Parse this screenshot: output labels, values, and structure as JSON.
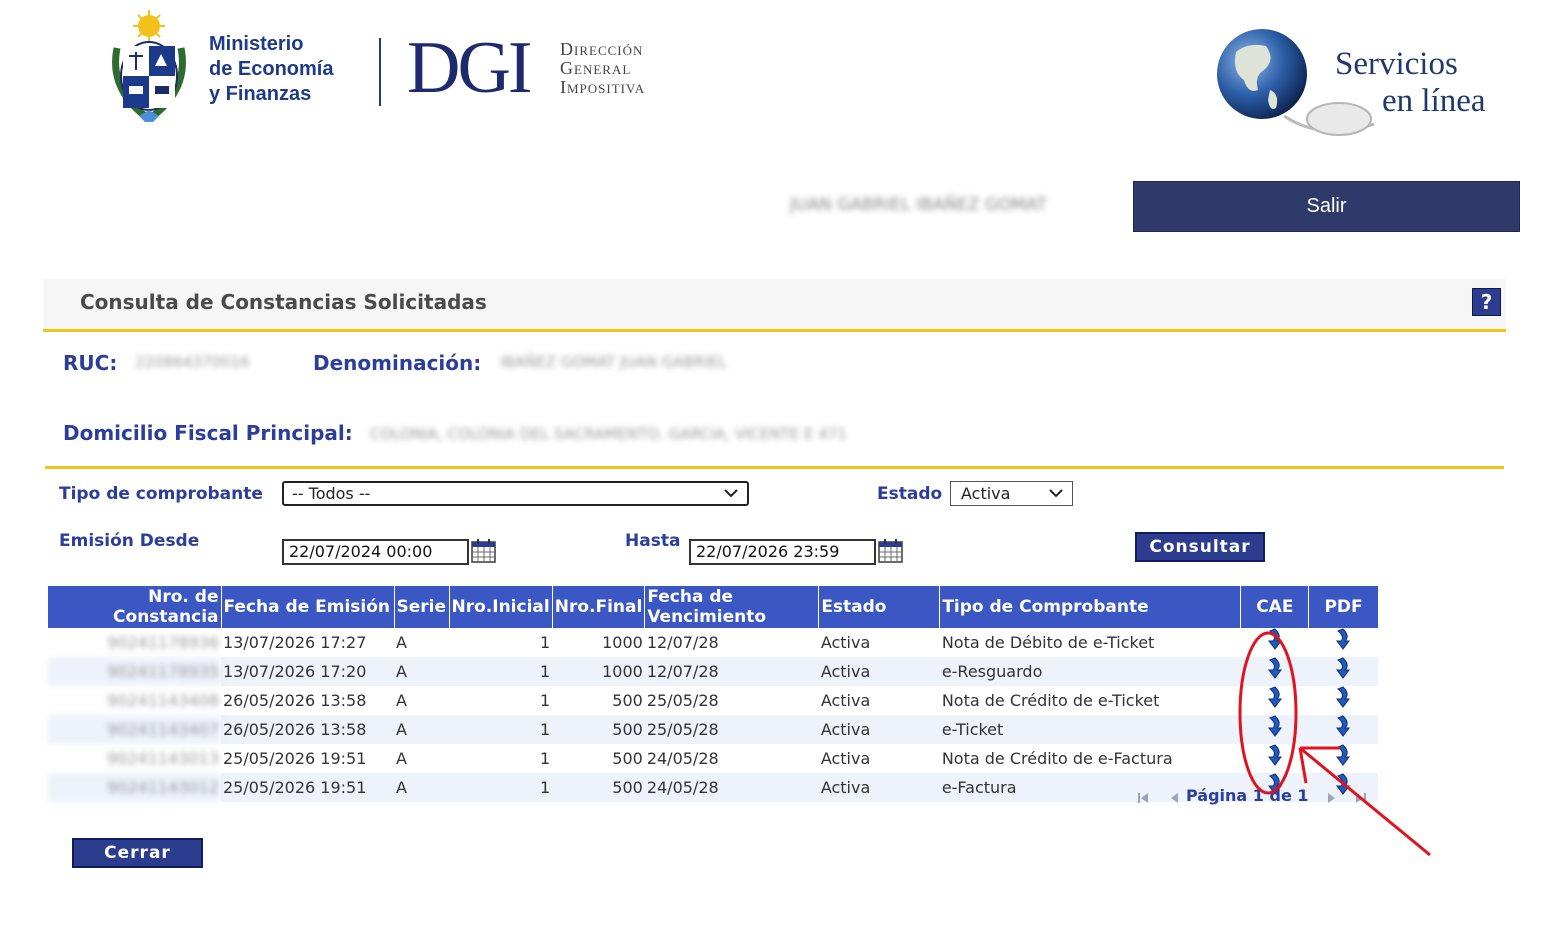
{
  "header": {
    "ministry_lines": [
      "Ministerio",
      "de Economía",
      "y Finanzas"
    ],
    "dgi_logo": "DGI",
    "dgi_lines": [
      "Dirección",
      "General",
      "Impositiva"
    ],
    "services_line1": "Servicios",
    "services_line2": "en línea",
    "user_name_blurred": "JUAN GABRIEL IBAÑEZ GOMAT",
    "logout_label": "Salir"
  },
  "panel": {
    "title": "Consulta de Constancias Solicitadas",
    "help_icon": "?"
  },
  "taxpayer": {
    "ruc_label": "RUC:",
    "ruc_value_blurred": "220864370016",
    "denominacion_label": "Denominación:",
    "denominacion_value_blurred": "IBAÑEZ GOMAT JUAN GABRIEL",
    "domicilio_label": "Domicilio Fiscal Principal:",
    "domicilio_value_blurred": "COLONIA, COLONIA DEL SACRAMENTO, GARCIA, VICENTE E 471"
  },
  "filters": {
    "tipo_label": "Tipo de comprobante",
    "tipo_value": "-- Todos --",
    "estado_label": "Estado",
    "estado_value": "Activa",
    "desde_label": "Emisión Desde",
    "desde_value": "22/07/2024 00:00",
    "hasta_label": "Hasta",
    "hasta_value": "22/07/2026 23:59",
    "consultar_label": "Consultar"
  },
  "table": {
    "columns": {
      "nro_l1": "Nro. de",
      "nro_l2": "Constancia",
      "fecha": "Fecha de Emisión",
      "serie": "Serie",
      "ini": "Nro.Inicial",
      "fin": "Nro.Final",
      "venc_l1": "Fecha de",
      "venc_l2": "Vencimiento",
      "estado": "Estado",
      "tipo": "Tipo de Comprobante",
      "cae": "CAE",
      "pdf": "PDF"
    },
    "rows": [
      {
        "nro": "90241178936",
        "fecha": "13/07/2026 17:27",
        "serie": "A",
        "ini": "1",
        "fin": "1000",
        "venc": "12/07/28",
        "estado": "Activa",
        "tipo": "Nota de Débito de e-Ticket"
      },
      {
        "nro": "90241178935",
        "fecha": "13/07/2026 17:20",
        "serie": "A",
        "ini": "1",
        "fin": "1000",
        "venc": "12/07/28",
        "estado": "Activa",
        "tipo": "e-Resguardo"
      },
      {
        "nro": "90241143408",
        "fecha": "26/05/2026 13:58",
        "serie": "A",
        "ini": "1",
        "fin": "500",
        "venc": "25/05/28",
        "estado": "Activa",
        "tipo": "Nota de Crédito de e-Ticket"
      },
      {
        "nro": "90241143407",
        "fecha": "26/05/2026 13:58",
        "serie": "A",
        "ini": "1",
        "fin": "500",
        "venc": "25/05/28",
        "estado": "Activa",
        "tipo": "e-Ticket"
      },
      {
        "nro": "90241143013",
        "fecha": "25/05/2026 19:51",
        "serie": "A",
        "ini": "1",
        "fin": "500",
        "venc": "24/05/28",
        "estado": "Activa",
        "tipo": "Nota de Crédito de e-Factura"
      },
      {
        "nro": "90241143012",
        "fecha": "25/05/2026 19:51",
        "serie": "A",
        "ini": "1",
        "fin": "500",
        "venc": "24/05/28",
        "estado": "Activa",
        "tipo": "e-Factura"
      }
    ]
  },
  "pager": {
    "text": "Página 1 de 1"
  },
  "footer": {
    "close_label": "Cerrar"
  },
  "colors": {
    "navy": "#2c3d8f",
    "table_header": "#3a57c4",
    "accent_yellow": "#f0c419",
    "annotation_red": "#e0141e"
  }
}
